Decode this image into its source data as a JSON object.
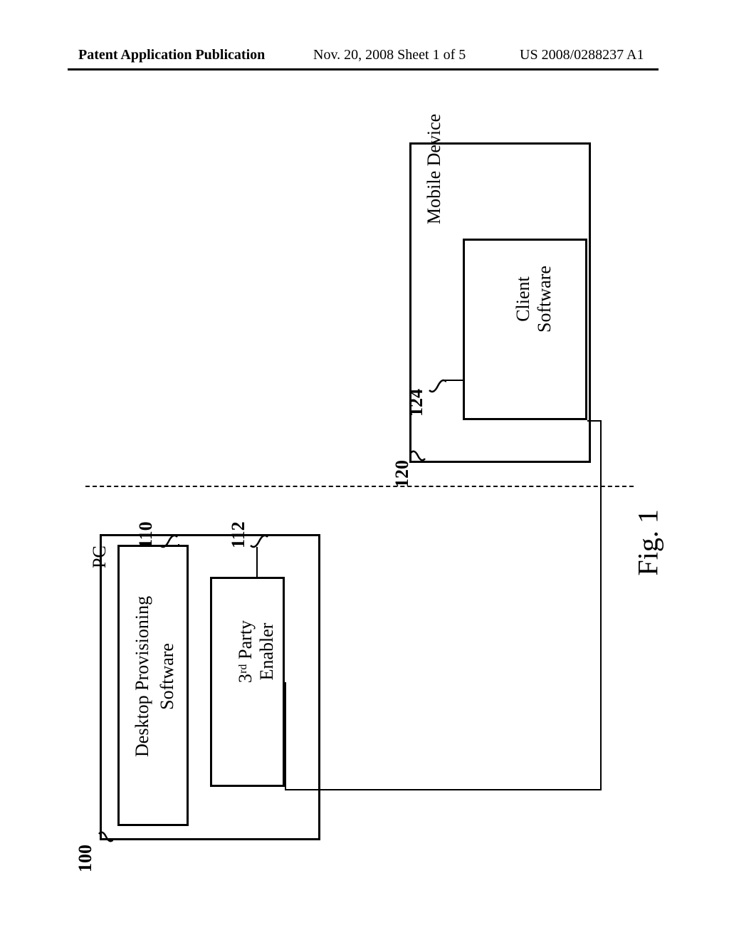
{
  "header": {
    "left": "Patent Application Publication",
    "middle": "Nov. 20, 2008  Sheet 1 of 5",
    "right": "US 2008/0288237 A1"
  },
  "diagram": {
    "pc": {
      "title": "PC",
      "ref": "100",
      "box1": {
        "label_line1": "Desktop Provisioning",
        "label_line2": "Software",
        "ref": "110"
      },
      "box2": {
        "label_line1": "3ʳᵈ Party",
        "label_line2": "Enabler",
        "ref": "112"
      }
    },
    "mobile": {
      "title": "Mobile Device",
      "ref": "120",
      "box": {
        "label_line1": "Client",
        "label_line2": "Software",
        "ref": "124"
      }
    },
    "caption": "Fig. 1"
  }
}
